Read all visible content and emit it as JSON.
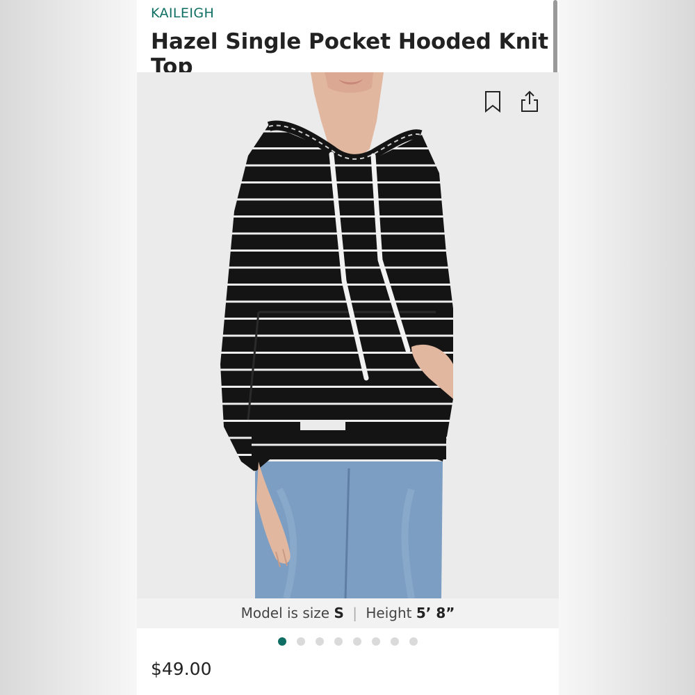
{
  "product": {
    "brand": "KAILEIGH",
    "title": "Hazel Single Pocket Hooded Knit Top",
    "price": "$49.00"
  },
  "image": {
    "description_icon": "striped-hoodie-model-photo",
    "caption": {
      "size_label": "Model is size",
      "size_value": "S",
      "separator": "|",
      "height_label": "Height",
      "height_value": "5’ 8”"
    }
  },
  "actions": {
    "bookmark_icon": "bookmark-icon",
    "share_icon": "share-icon"
  },
  "carousel": {
    "total": 8,
    "active_index": 0
  },
  "colors": {
    "brand": "#0f6e63",
    "hoodie": "#141414",
    "stripe": "#f0f0f0",
    "jeans": "#7c9ec2"
  }
}
